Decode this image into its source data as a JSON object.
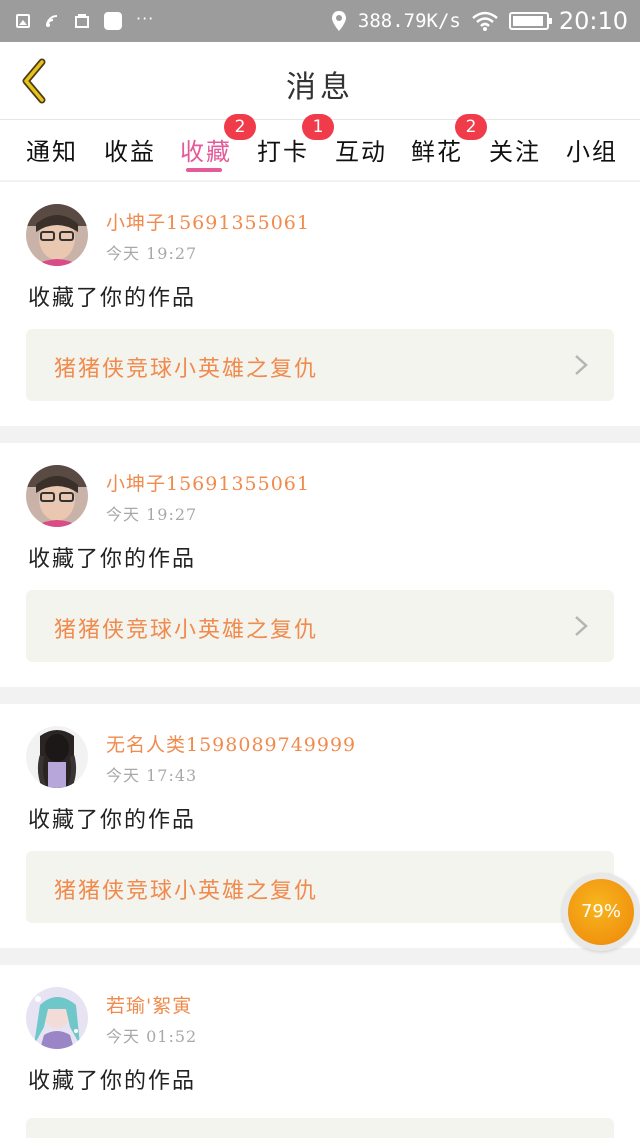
{
  "status_bar": {
    "dots": "···",
    "speed": "388.79K/s",
    "time": "20:10",
    "icons": [
      "image-icon",
      "signal-icon",
      "notification-icon",
      "app-icon",
      "location-icon",
      "wifi-icon",
      "battery-icon"
    ]
  },
  "header": {
    "title": "消息",
    "back_icon": "chevron-left-icon",
    "accent_color": "#e7c21a"
  },
  "tabs": [
    {
      "label": "通知"
    },
    {
      "label": "收益"
    },
    {
      "label": "收藏",
      "active": true
    },
    {
      "label": "打卡"
    },
    {
      "label": "互动"
    },
    {
      "label": "鲜花"
    },
    {
      "label": "关注"
    },
    {
      "label": "小组"
    }
  ],
  "badges": [
    "2",
    "1",
    "2"
  ],
  "messages": [
    {
      "name": "小坤子15691355061",
      "time": "今天 19:27",
      "action": "收藏了你的作品",
      "work": "猪猪侠竞球小英雄之复仇"
    },
    {
      "name": "小坤子15691355061",
      "time": "今天 19:27",
      "action": "收藏了你的作品",
      "work": "猪猪侠竞球小英雄之复仇"
    },
    {
      "name": "无名人类1598089749999",
      "time": "今天 17:43",
      "action": "收藏了你的作品",
      "work": "猪猪侠竞球小英雄之复仇"
    },
    {
      "name": "若瑜'絮寅",
      "time": "今天 01:52",
      "action": "收藏了你的作品",
      "work": ""
    }
  ],
  "floating": {
    "label": "79%"
  },
  "colors": {
    "active_tab": "#e45b9a",
    "badge": "#f03c4a",
    "name": "#f08a4d",
    "work": "#f08a4d",
    "status_bar": "#9c9c9c"
  }
}
